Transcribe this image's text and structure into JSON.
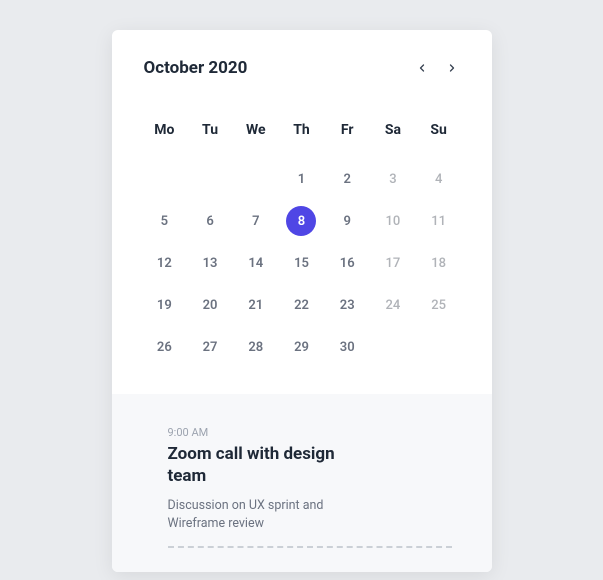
{
  "title": "October 2020",
  "dow": [
    "Mo",
    "Tu",
    "We",
    "Th",
    "Fr",
    "Sa",
    "Su"
  ],
  "weekend_cols": [
    5,
    6
  ],
  "selected_day": 8,
  "weeks": [
    [
      "",
      "",
      "",
      "1",
      "2",
      "3",
      "4"
    ],
    [
      "5",
      "6",
      "7",
      "8",
      "9",
      "10",
      "11"
    ],
    [
      "12",
      "13",
      "14",
      "15",
      "16",
      "17",
      "18"
    ],
    [
      "19",
      "20",
      "21",
      "22",
      "23",
      "24",
      "25"
    ],
    [
      "26",
      "27",
      "28",
      "29",
      "30",
      "",
      ""
    ]
  ],
  "event": {
    "time": "9:00 AM",
    "title": "Zoom call with design team",
    "desc": "Discussion on UX sprint and Wireframe review"
  }
}
